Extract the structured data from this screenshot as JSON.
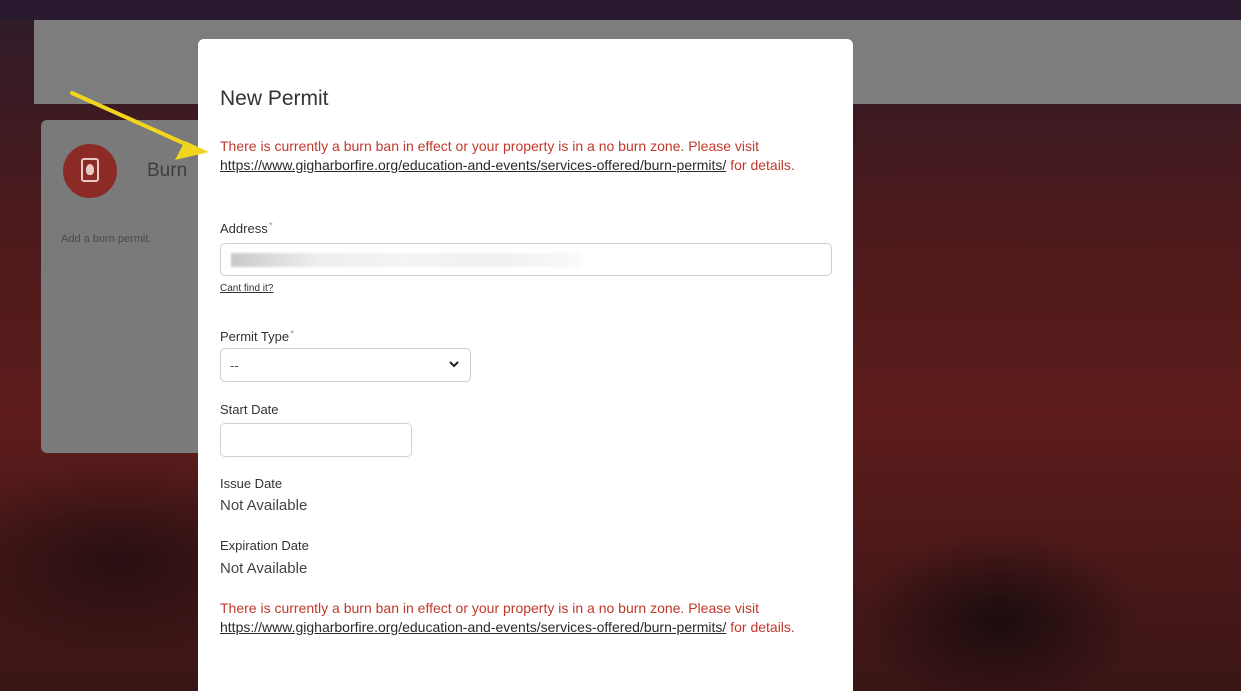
{
  "background_card": {
    "title": "Burn",
    "description": "Add a burn permit."
  },
  "modal": {
    "title": "New Permit",
    "warning": {
      "prefix": "There is currently a burn ban in effect or your property is in a no burn zone. Please visit ",
      "link": "https://www.gigharborfire.org/education-and-events/services-offered/burn-permits/",
      "suffix": " for details."
    },
    "address": {
      "label": "Address",
      "required_mark": "*",
      "cant_find": "Cant find it?"
    },
    "permit_type": {
      "label": "Permit Type",
      "required_mark": "*",
      "selected": "--"
    },
    "start_date": {
      "label": "Start Date"
    },
    "issue_date": {
      "label": "Issue Date",
      "value": "Not Available"
    },
    "expiration_date": {
      "label": "Expiration Date",
      "value": "Not Available"
    }
  },
  "colors": {
    "warning": "#c0392b",
    "save_button": "#c0393d",
    "annotation_arrow": "#f2d51f"
  },
  "icons": {
    "permit": "fire-permit-icon",
    "select": "chevron-down-icon",
    "annotation": "arrow-icon"
  }
}
